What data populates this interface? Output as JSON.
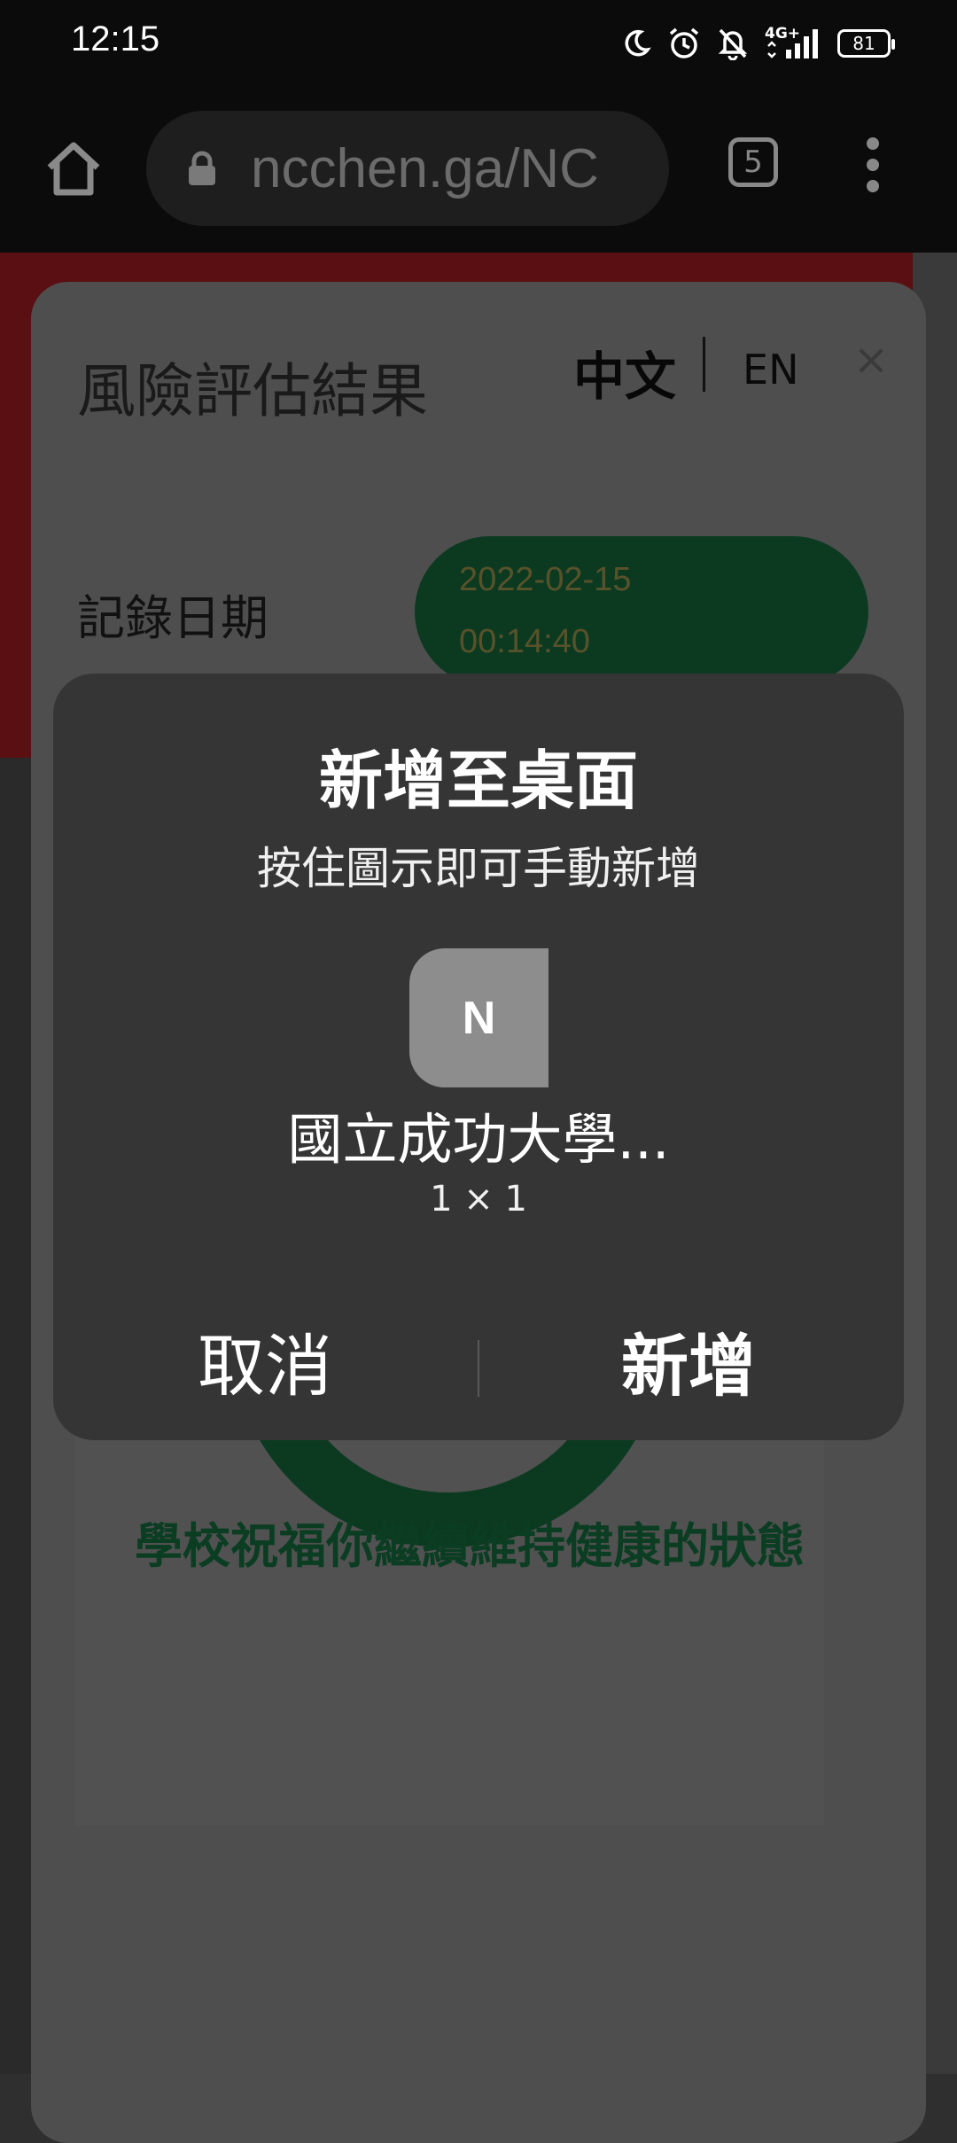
{
  "status_bar": {
    "time": "12:15",
    "network": "4G+",
    "battery": "81",
    "icons": [
      "moon-icon",
      "alarm-icon",
      "bell-off-icon",
      "signal-icon",
      "battery-icon"
    ]
  },
  "browser": {
    "url": "ncchen.ga/NC",
    "tab_count": "5"
  },
  "card": {
    "title": "風險評估結果",
    "lang_zh": "中文",
    "lang_en": "EN",
    "close": "×",
    "date_label": "記錄日期",
    "date": "2022-02-15",
    "time": "00:14:40",
    "message": "學校祝福你繼續維持健康的狀態"
  },
  "dialog": {
    "title": "新增至桌面",
    "subtitle": "按住圖示即可手動新增",
    "app_icon_letter": "N",
    "app_name": "國立成功大學...",
    "app_size": "1 × 1",
    "cancel_label": "取消",
    "add_label": "新增"
  },
  "colors": {
    "dialog_bg": "#353535",
    "accent_green": "#0c3a21",
    "status_bar_bg": "#0b0b0b"
  }
}
